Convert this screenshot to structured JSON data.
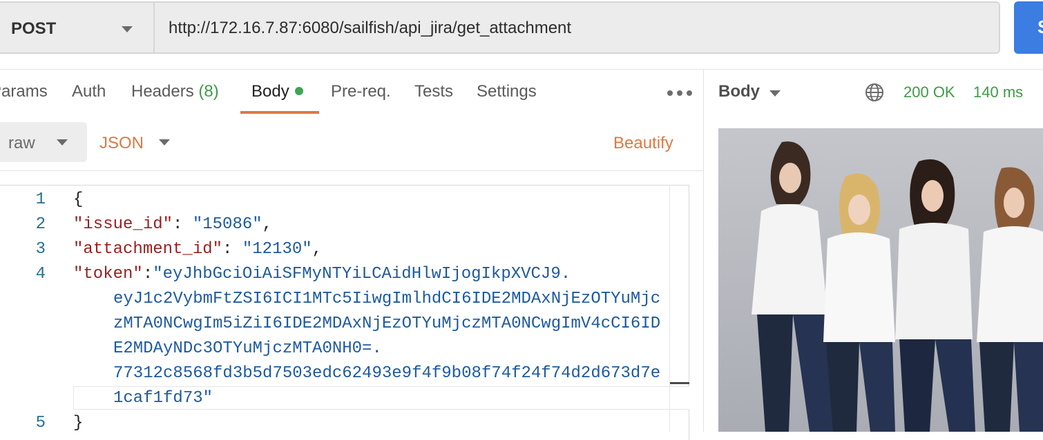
{
  "request": {
    "method": "POST",
    "url": "http://172.16.7.87:6080/sailfish/api_jira/get_attachment",
    "send_label": "S"
  },
  "tabs": {
    "params": "Params",
    "auth": "Auth",
    "headers": "Headers",
    "headers_count": "(8)",
    "body": "Body",
    "prereq": "Pre-req.",
    "tests": "Tests",
    "settings": "Settings",
    "active": "Body"
  },
  "body_options": {
    "mode": "raw",
    "language": "JSON",
    "beautify_label": "Beautify"
  },
  "editor": {
    "line_numbers": [
      "1",
      "2",
      "3",
      "4",
      "5"
    ],
    "line1": "{",
    "line2_key": "\"issue_id\"",
    "line2_sep": ": ",
    "line2_val": "\"15086\"",
    "line2_end": ",",
    "line3_key": "\"attachment_id\"",
    "line3_sep": ": ",
    "line3_val": "\"12130\"",
    "line3_end": ",",
    "line4_key": "\"token\"",
    "line4_sep": ":",
    "token_lines": [
      "\"eyJhbGciOiAiSFMyNTYiLCAidHlwIjogIkpXVCJ9.",
      "eyJ1c2VybmFtZSI6ICI1MTc5IiwgImlhdCI6IDE2MDAxNjEzOTYuMjc",
      "zMTA0NCwgIm5iZiI6IDE2MDAxNjEzOTYuMjczMTA0NCwgImV4cCI6ID",
      "E2MDAyNDc3OTYuMjczMTA0NH0=.",
      "77312c8568fd3b5d7503edc62493e9f4f9b08f74f24f74d2d673d7e",
      "1caf1fd73\""
    ],
    "line5": "}"
  },
  "response": {
    "body_label": "Body",
    "status": "200 OK",
    "time": "140 ms"
  },
  "colors": {
    "accent": "#e07840",
    "status_green": "#3e9a45",
    "send_blue": "#3b7de0",
    "json_key": "#9a1f1f",
    "json_string": "#1d5aa0"
  },
  "icons": [
    "chevron-down-icon",
    "more-horizontal-icon",
    "globe-icon"
  ]
}
